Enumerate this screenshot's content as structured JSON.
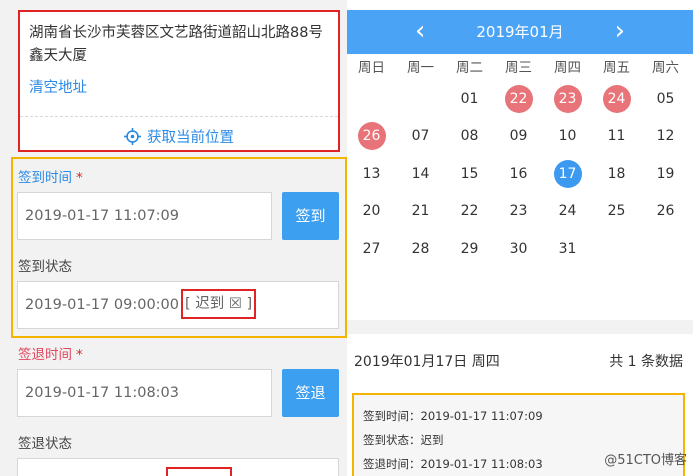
{
  "address": {
    "text": "湖南省长沙市芙蓉区文艺路街道韶山北路88号鑫天大厦",
    "clear_label": "清空地址",
    "locate_label": "获取当前位置"
  },
  "signin": {
    "time_label": "签到时间",
    "required_mark": "*",
    "time_value": "2019-01-17 11:07:09",
    "button_label": "签到",
    "status_label": "签到状态",
    "status_time": "2019-01-17 09:00:00",
    "status_tag": "[ 迟到 ☒ ]"
  },
  "signout": {
    "time_label": "签退时间",
    "required_mark": "*",
    "time_value": "2019-01-17 11:08:03",
    "button_label": "签退",
    "status_label": "签退状态"
  },
  "calendar": {
    "title": "2019年01月",
    "prev_icon": "‹",
    "next_icon": "›",
    "weekdays": [
      "周日",
      "周一",
      "周二",
      "周三",
      "周四",
      "周五",
      "周六"
    ],
    "first_weekday_index": 2,
    "days_in_month": 31,
    "red_days": [
      2,
      3,
      4,
      6
    ],
    "selected_day": 17,
    "colors": {
      "header": "#4aa3f5",
      "red": "#e87379",
      "selected": "#3b9af0"
    }
  },
  "summary": {
    "date_text": "2019年01月17日 周四",
    "count_text": "共 1 条数据"
  },
  "record": {
    "lines": [
      "签到时间：2019-01-17 11:07:09",
      "签到状态：迟到",
      "签退时间：2019-01-17 11:08:03"
    ]
  },
  "watermark": "@51CTO博客"
}
